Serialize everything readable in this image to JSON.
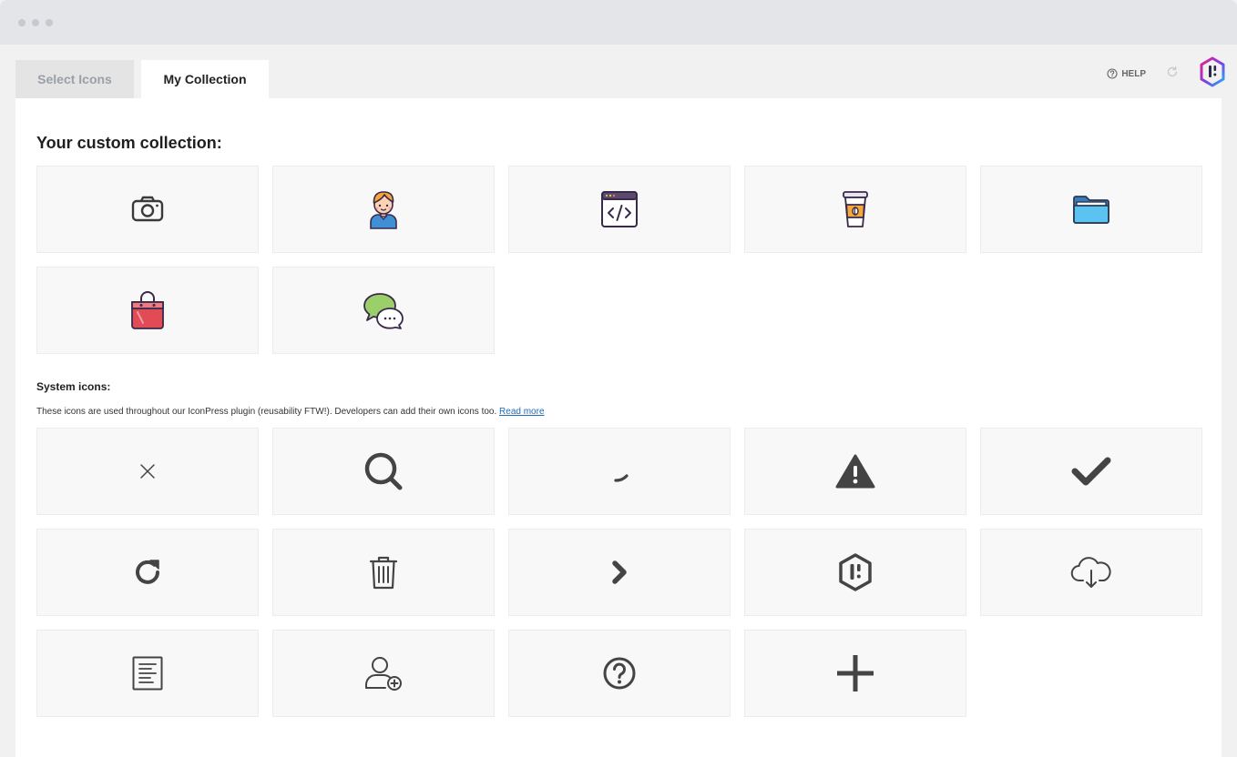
{
  "tabs": [
    {
      "label": "Select Icons",
      "active": false
    },
    {
      "label": "My Collection",
      "active": true
    }
  ],
  "toolbar": {
    "help_label": "HELP",
    "help_icon": "help-circle-icon",
    "refresh_icon": "refresh-icon",
    "logo_icon": "iconpress-logo-icon"
  },
  "custom_section": {
    "heading": "Your custom collection:",
    "icons": [
      "camera-icon",
      "boy-avatar-icon",
      "code-window-icon",
      "coffee-cup-icon",
      "folder-icon",
      "shopping-bag-icon",
      "chat-bubbles-icon"
    ]
  },
  "system_section": {
    "heading": "System icons:",
    "description": "These icons are used throughout our IconPress plugin (reusability FTW!). Developers can add their own icons too.",
    "read_more_label": "Read more",
    "icons": [
      "close-icon",
      "search-icon",
      "spinner-icon",
      "warning-icon",
      "checkmark-icon",
      "refresh-icon",
      "trash-icon",
      "chevron-right-icon",
      "iconpress-hex-icon",
      "cloud-download-icon",
      "document-icon",
      "add-user-icon",
      "question-circle-icon",
      "plus-icon"
    ]
  },
  "colors": {
    "accent_link": "#1e6bb8",
    "logo_gradient_start": "#e91e8c",
    "logo_gradient_end": "#2d7cf6",
    "icon_dark": "#444444"
  }
}
